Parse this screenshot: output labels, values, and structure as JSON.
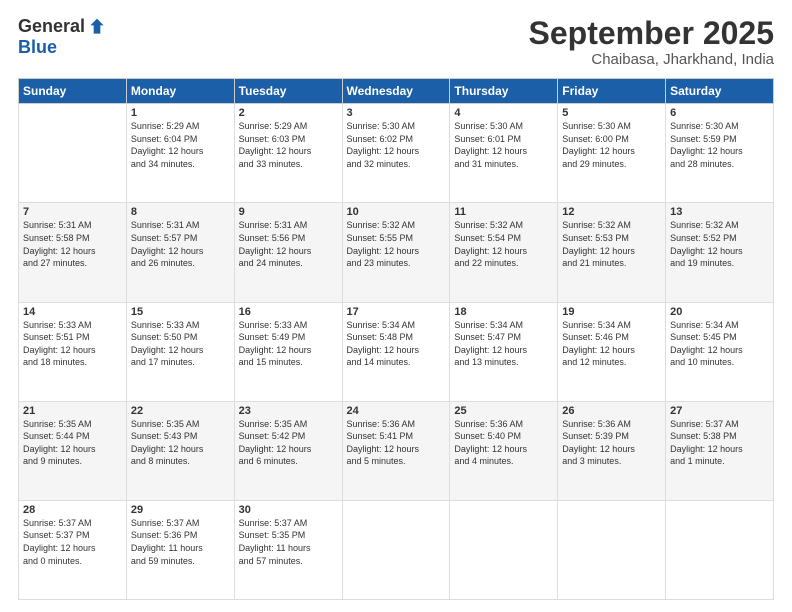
{
  "logo": {
    "general": "General",
    "blue": "Blue"
  },
  "header": {
    "month": "September 2025",
    "location": "Chaibasa, Jharkhand, India"
  },
  "weekdays": [
    "Sunday",
    "Monday",
    "Tuesday",
    "Wednesday",
    "Thursday",
    "Friday",
    "Saturday"
  ],
  "weeks": [
    [
      {
        "day": "",
        "info": ""
      },
      {
        "day": "1",
        "info": "Sunrise: 5:29 AM\nSunset: 6:04 PM\nDaylight: 12 hours\nand 34 minutes."
      },
      {
        "day": "2",
        "info": "Sunrise: 5:29 AM\nSunset: 6:03 PM\nDaylight: 12 hours\nand 33 minutes."
      },
      {
        "day": "3",
        "info": "Sunrise: 5:30 AM\nSunset: 6:02 PM\nDaylight: 12 hours\nand 32 minutes."
      },
      {
        "day": "4",
        "info": "Sunrise: 5:30 AM\nSunset: 6:01 PM\nDaylight: 12 hours\nand 31 minutes."
      },
      {
        "day": "5",
        "info": "Sunrise: 5:30 AM\nSunset: 6:00 PM\nDaylight: 12 hours\nand 29 minutes."
      },
      {
        "day": "6",
        "info": "Sunrise: 5:30 AM\nSunset: 5:59 PM\nDaylight: 12 hours\nand 28 minutes."
      }
    ],
    [
      {
        "day": "7",
        "info": "Sunrise: 5:31 AM\nSunset: 5:58 PM\nDaylight: 12 hours\nand 27 minutes."
      },
      {
        "day": "8",
        "info": "Sunrise: 5:31 AM\nSunset: 5:57 PM\nDaylight: 12 hours\nand 26 minutes."
      },
      {
        "day": "9",
        "info": "Sunrise: 5:31 AM\nSunset: 5:56 PM\nDaylight: 12 hours\nand 24 minutes."
      },
      {
        "day": "10",
        "info": "Sunrise: 5:32 AM\nSunset: 5:55 PM\nDaylight: 12 hours\nand 23 minutes."
      },
      {
        "day": "11",
        "info": "Sunrise: 5:32 AM\nSunset: 5:54 PM\nDaylight: 12 hours\nand 22 minutes."
      },
      {
        "day": "12",
        "info": "Sunrise: 5:32 AM\nSunset: 5:53 PM\nDaylight: 12 hours\nand 21 minutes."
      },
      {
        "day": "13",
        "info": "Sunrise: 5:32 AM\nSunset: 5:52 PM\nDaylight: 12 hours\nand 19 minutes."
      }
    ],
    [
      {
        "day": "14",
        "info": "Sunrise: 5:33 AM\nSunset: 5:51 PM\nDaylight: 12 hours\nand 18 minutes."
      },
      {
        "day": "15",
        "info": "Sunrise: 5:33 AM\nSunset: 5:50 PM\nDaylight: 12 hours\nand 17 minutes."
      },
      {
        "day": "16",
        "info": "Sunrise: 5:33 AM\nSunset: 5:49 PM\nDaylight: 12 hours\nand 15 minutes."
      },
      {
        "day": "17",
        "info": "Sunrise: 5:34 AM\nSunset: 5:48 PM\nDaylight: 12 hours\nand 14 minutes."
      },
      {
        "day": "18",
        "info": "Sunrise: 5:34 AM\nSunset: 5:47 PM\nDaylight: 12 hours\nand 13 minutes."
      },
      {
        "day": "19",
        "info": "Sunrise: 5:34 AM\nSunset: 5:46 PM\nDaylight: 12 hours\nand 12 minutes."
      },
      {
        "day": "20",
        "info": "Sunrise: 5:34 AM\nSunset: 5:45 PM\nDaylight: 12 hours\nand 10 minutes."
      }
    ],
    [
      {
        "day": "21",
        "info": "Sunrise: 5:35 AM\nSunset: 5:44 PM\nDaylight: 12 hours\nand 9 minutes."
      },
      {
        "day": "22",
        "info": "Sunrise: 5:35 AM\nSunset: 5:43 PM\nDaylight: 12 hours\nand 8 minutes."
      },
      {
        "day": "23",
        "info": "Sunrise: 5:35 AM\nSunset: 5:42 PM\nDaylight: 12 hours\nand 6 minutes."
      },
      {
        "day": "24",
        "info": "Sunrise: 5:36 AM\nSunset: 5:41 PM\nDaylight: 12 hours\nand 5 minutes."
      },
      {
        "day": "25",
        "info": "Sunrise: 5:36 AM\nSunset: 5:40 PM\nDaylight: 12 hours\nand 4 minutes."
      },
      {
        "day": "26",
        "info": "Sunrise: 5:36 AM\nSunset: 5:39 PM\nDaylight: 12 hours\nand 3 minutes."
      },
      {
        "day": "27",
        "info": "Sunrise: 5:37 AM\nSunset: 5:38 PM\nDaylight: 12 hours\nand 1 minute."
      }
    ],
    [
      {
        "day": "28",
        "info": "Sunrise: 5:37 AM\nSunset: 5:37 PM\nDaylight: 12 hours\nand 0 minutes."
      },
      {
        "day": "29",
        "info": "Sunrise: 5:37 AM\nSunset: 5:36 PM\nDaylight: 11 hours\nand 59 minutes."
      },
      {
        "day": "30",
        "info": "Sunrise: 5:37 AM\nSunset: 5:35 PM\nDaylight: 11 hours\nand 57 minutes."
      },
      {
        "day": "",
        "info": ""
      },
      {
        "day": "",
        "info": ""
      },
      {
        "day": "",
        "info": ""
      },
      {
        "day": "",
        "info": ""
      }
    ]
  ]
}
